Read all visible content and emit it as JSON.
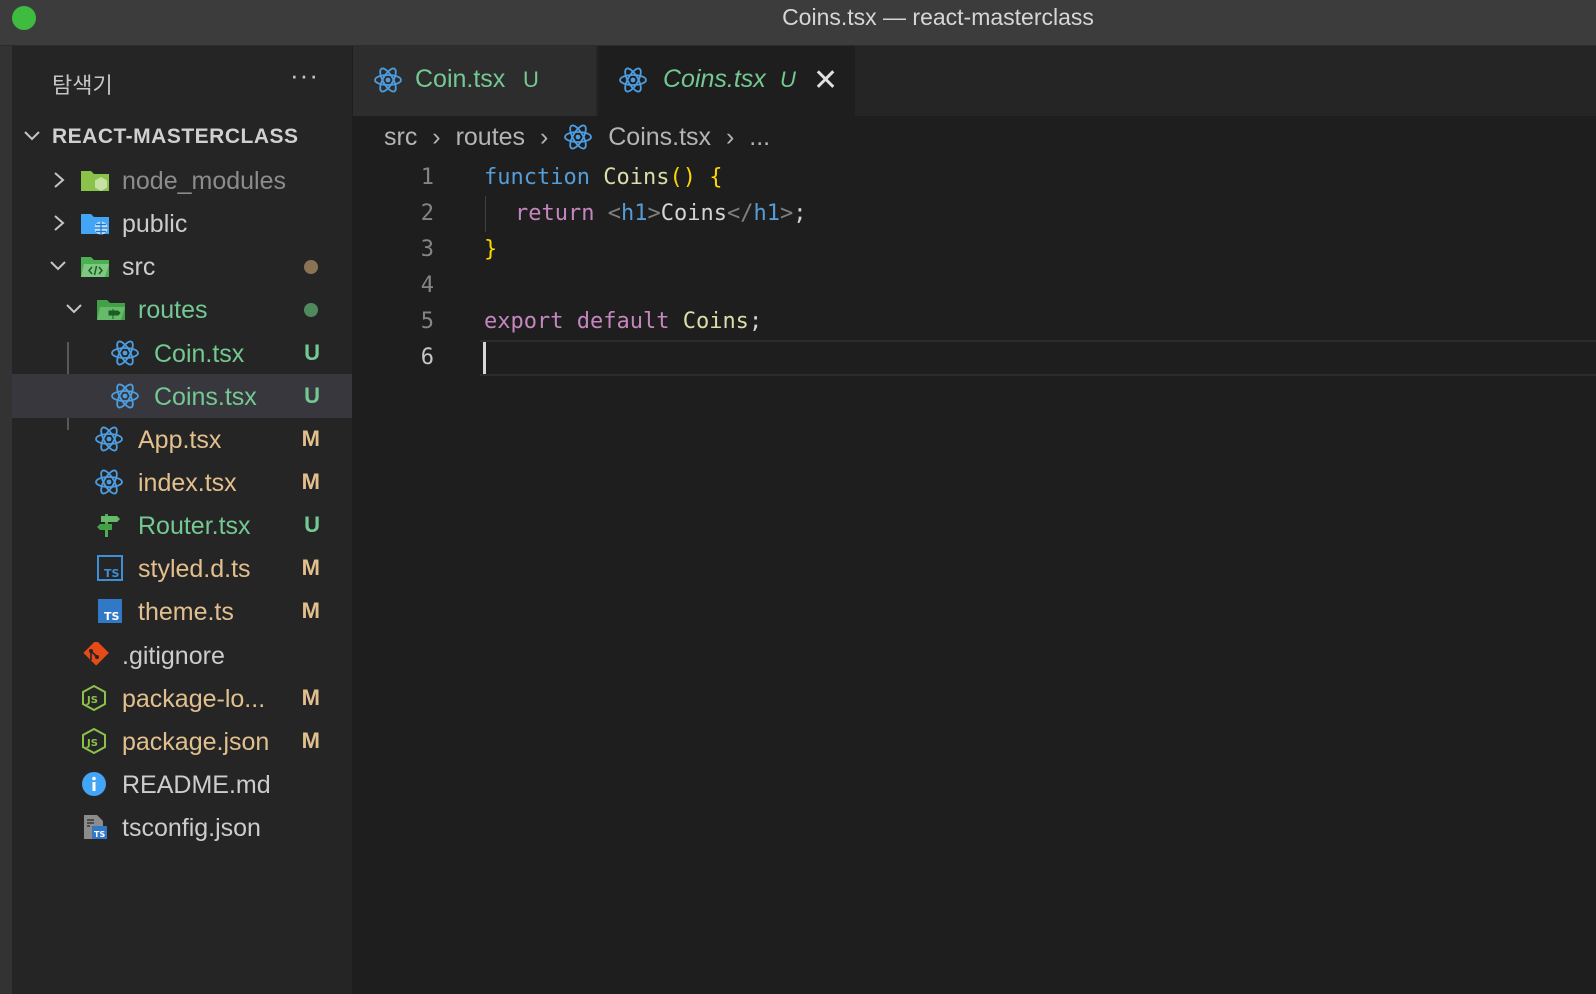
{
  "window": {
    "title": "Coins.tsx — react-masterclass"
  },
  "colors": {
    "modified": "#e2c08d",
    "untracked": "#73c991",
    "ignored": "#8c8c8c",
    "accent_react": "#4d9de0"
  },
  "sidebar": {
    "title": "탐색기",
    "more": "···",
    "project_name": "REACT-MASTERCLASS",
    "items": [
      {
        "name": "node_modules",
        "icon": "node-folder-icon",
        "badge": ""
      },
      {
        "name": "public",
        "icon": "public-folder-icon",
        "badge": ""
      },
      {
        "name": "src",
        "icon": "src-folder-icon",
        "badge": ""
      },
      {
        "name": "routes",
        "icon": "routes-folder-icon",
        "badge": ""
      },
      {
        "name": "Coin.tsx",
        "icon": "react-icon",
        "badge": "U"
      },
      {
        "name": "Coins.tsx",
        "icon": "react-icon",
        "badge": "U"
      },
      {
        "name": "App.tsx",
        "icon": "react-icon",
        "badge": "M"
      },
      {
        "name": "index.tsx",
        "icon": "react-icon",
        "badge": "M"
      },
      {
        "name": "Router.tsx",
        "icon": "signpost-icon",
        "badge": "U"
      },
      {
        "name": "styled.d.ts",
        "icon": "typescript-def-icon",
        "badge": "M"
      },
      {
        "name": "theme.ts",
        "icon": "typescript-icon",
        "badge": "M"
      },
      {
        "name": ".gitignore",
        "icon": "git-icon",
        "badge": ""
      },
      {
        "name": "package-lo...",
        "icon": "nodejs-icon",
        "badge": "M"
      },
      {
        "name": "package.json",
        "icon": "nodejs-icon",
        "badge": "M"
      },
      {
        "name": "README.md",
        "icon": "info-icon",
        "badge": ""
      },
      {
        "name": "tsconfig.json",
        "icon": "tsconfig-icon",
        "badge": ""
      }
    ]
  },
  "tabs": [
    {
      "name": "Coin.tsx",
      "badge": "U",
      "active": false
    },
    {
      "name": "Coins.tsx",
      "badge": "U",
      "active": true,
      "close": "✕"
    }
  ],
  "breadcrumb": {
    "parts": [
      "src",
      "routes",
      "Coins.tsx",
      "..."
    ],
    "separator": "›"
  },
  "editor": {
    "lines": [
      {
        "n": "1"
      },
      {
        "n": "2"
      },
      {
        "n": "3"
      },
      {
        "n": "4"
      },
      {
        "n": "5"
      },
      {
        "n": "6"
      }
    ],
    "tokens": {
      "l1_kw": "function",
      "l1_fn": "Coins",
      "l1_paren": "()",
      "l1_brace": "{",
      "l2_kw": "return",
      "l2_lt": "<",
      "l2_tag": "h1",
      "l2_gt": ">",
      "l2_text": "Coins",
      "l2_lt2": "</",
      "l2_tag2": "h1",
      "l2_gt2": ">",
      "l2_semi": ";",
      "l3_brace": "}",
      "l5_kw1": "export",
      "l5_kw2": "default",
      "l5_id": "Coins",
      "l5_semi": ";"
    }
  }
}
